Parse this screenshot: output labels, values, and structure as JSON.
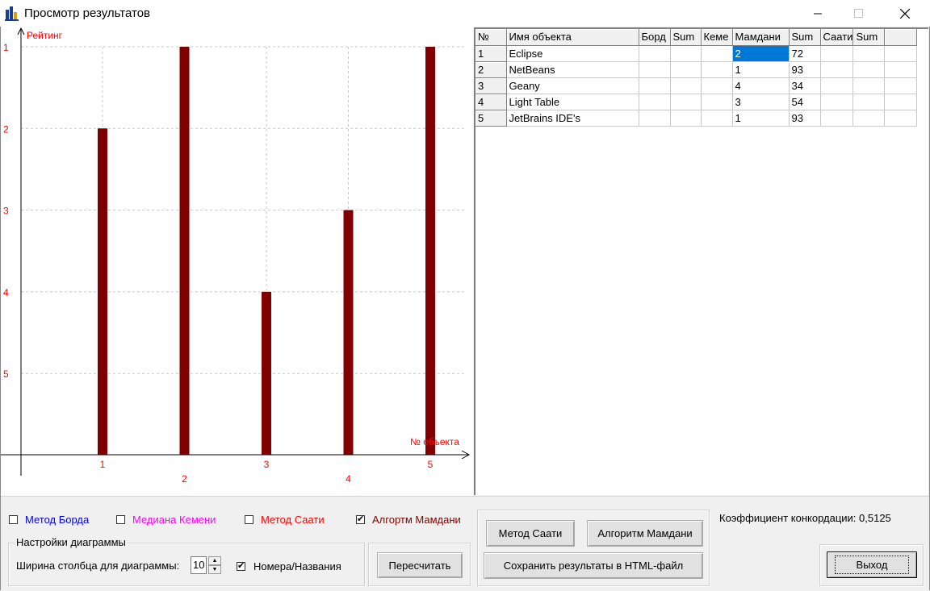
{
  "window": {
    "title": "Просмотр результатов",
    "minimize_icon": "minimize-icon",
    "maximize_icon": "maximize-icon",
    "close_icon": "close-icon"
  },
  "chart_data": {
    "type": "bar",
    "ylabel": "Рейтинг",
    "xlabel": "№ объекта",
    "y_ticks": [
      "1",
      "2",
      "3",
      "4",
      "5"
    ],
    "y_axis_inverted": true,
    "ylim": [
      1,
      6
    ],
    "categories": [
      "1",
      "2",
      "3",
      "4",
      "5"
    ],
    "series": [
      {
        "name": "Алгортм Мамдани",
        "values": [
          2,
          1,
          4,
          3,
          1
        ]
      }
    ],
    "bar_color": "#800000",
    "label_color": "#ff0000",
    "grid": true
  },
  "table": {
    "headers": [
      "№",
      "Имя объекта",
      "Борд",
      "Sum",
      "Кеме",
      "Мамдани",
      "Sum",
      "Саати",
      "Sum",
      ""
    ],
    "rows": [
      [
        "1",
        "Eclipse",
        "",
        "",
        "",
        "2",
        "72",
        "",
        "",
        ""
      ],
      [
        "2",
        "NetBeans",
        "",
        "",
        "",
        "1",
        "93",
        "",
        "",
        ""
      ],
      [
        "3",
        "Geany",
        "",
        "",
        "",
        "4",
        "34",
        "",
        "",
        ""
      ],
      [
        "4",
        "Light Table",
        "",
        "",
        "",
        "3",
        "54",
        "",
        "",
        ""
      ],
      [
        "5",
        "JetBrains IDE's",
        "",
        "",
        "",
        "1",
        "93",
        "",
        "",
        ""
      ]
    ],
    "selected_cell": "row 1, Мамдани"
  },
  "options": {
    "borda": {
      "label": "Метод Борда",
      "checked": false,
      "color": "#0000ff"
    },
    "kemeny": {
      "label": "Медиана Кемени",
      "checked": false,
      "color": "#ff00ff"
    },
    "saaty": {
      "label": "Метод Саати",
      "checked": false,
      "color": "#ff0000"
    },
    "mamdani": {
      "label": "Алгортм Мамдани",
      "checked": true,
      "color": "#800000"
    }
  },
  "diagram_settings": {
    "title": "Настройки диаграммы",
    "width_label": "Ширина столбца для диаграммы:",
    "width_value": "10",
    "numbers_names_label": "Номера/Названия",
    "numbers_names_checked": true
  },
  "buttons": {
    "recalculate": "Пересчитать",
    "saaty_method": "Метод Саати",
    "mamdani_algorithm": "Алгоритм Мамдани",
    "save_html": "Сохранить результаты в HTML-файл",
    "exit": "Выход"
  },
  "concordance": "Коэффициент конкордации: 0,5125"
}
